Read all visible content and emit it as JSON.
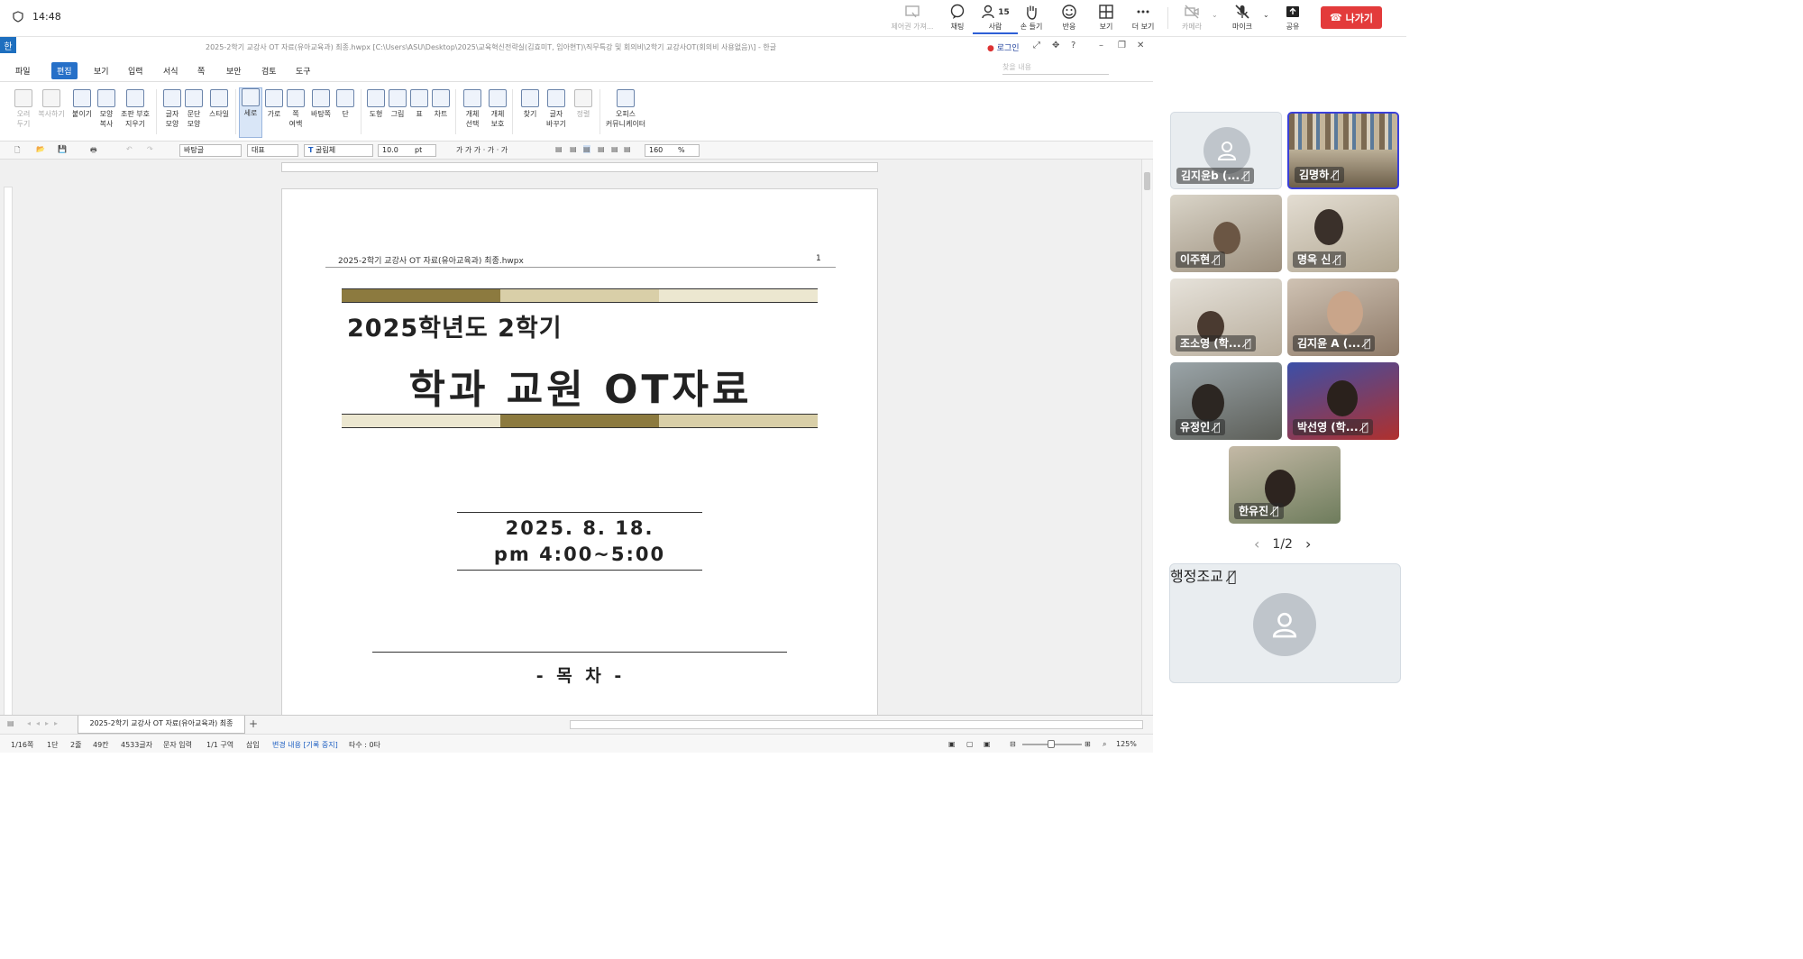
{
  "topbar": {
    "time": "14:48",
    "controls": [
      {
        "label": "제어권 가져...",
        "icon": "remote-control-icon"
      },
      {
        "label": "채팅",
        "icon": "chat-icon"
      },
      {
        "label": "사람",
        "icon": "people-icon",
        "count": "15"
      },
      {
        "label": "손 들기",
        "icon": "raise-hand-icon"
      },
      {
        "label": "반응",
        "icon": "reaction-icon"
      },
      {
        "label": "보기",
        "icon": "grid-view-icon"
      },
      {
        "label": "더 보기",
        "icon": "more-icon"
      },
      {
        "label": "카메라",
        "icon": "camera-off-icon"
      },
      {
        "label": "마이크",
        "icon": "mic-off-icon"
      },
      {
        "label": "공유",
        "icon": "share-icon"
      }
    ],
    "leave_label": "나가기"
  },
  "hwp": {
    "window_title": "2025-2학기 교강사 OT 자료(유아교육과) 최종.hwpx [C:\\Users\\ASU\\Desktop\\2025\\교육혁신전략실(김효미T, 임아현T)\\직무특강 및 회의비\\2학기 교강사OT(회의비 사용없음)\\] - 한글",
    "login": "로그인",
    "app_logo": "한",
    "menu": [
      "파일",
      "편집",
      "보기",
      "입력",
      "서식",
      "쪽",
      "보안",
      "검토",
      "도구"
    ],
    "menu_selected": "편집",
    "search_placeholder": "찾을 내용",
    "ribbon": [
      {
        "label": "오려\n두기",
        "dim": true
      },
      {
        "label": "복사하기",
        "dim": true
      },
      {
        "label": "붙이기"
      },
      {
        "label": "모양\n복사"
      },
      {
        "label": "조판 부호\n지우기"
      },
      {
        "label": "글자\n모양"
      },
      {
        "label": "문단\n모양"
      },
      {
        "label": "스타일"
      },
      {
        "label": "세로",
        "selected": true
      },
      {
        "label": "가로"
      },
      {
        "label": "쪽\n여백"
      },
      {
        "label": "바탕쪽"
      },
      {
        "label": "단"
      },
      {
        "label": "도형"
      },
      {
        "label": "그림"
      },
      {
        "label": "표"
      },
      {
        "label": "차트"
      },
      {
        "label": "개체\n선택"
      },
      {
        "label": "개체\n보호"
      },
      {
        "label": "찾기"
      },
      {
        "label": "글자\n바꾸기"
      },
      {
        "label": "정렬",
        "dim": true
      },
      {
        "label": "오피스\n커뮤니케이터"
      }
    ],
    "format": {
      "style": "바탕글",
      "lang": "대표",
      "font": "굴림체",
      "size": "10.0",
      "size_unit": "pt",
      "line_spacing": "160",
      "line_spacing_unit": "%",
      "glyphs": "가  가  가  ·  가  ·  가"
    },
    "document": {
      "header": "2025-2학기 교강사 OT 자료(유아교육과) 최종.hwpx",
      "page_number": "1",
      "title_line1": "2025학년도 2학기",
      "title_line2": "학과 교원 OT자료",
      "date": "2025. 8. 18.",
      "time": "pm 4:00~5:00",
      "toc": "- 목 차 -",
      "band_colors": {
        "dark": "#8c7a3f",
        "light": "#d9cfa8",
        "pale": "#ece7d0"
      }
    },
    "tab_name": "2025-2학기 교강사 OT 자료(유아교육과) 최종",
    "status": {
      "page": "1/16쪽",
      "column": "1단",
      "line": "2줄",
      "chars_pos": "49칸",
      "chars": "4533글자",
      "input": "문자 입력",
      "section": "1/1 구역",
      "mode": "삽입",
      "track": "변경 내용 [기록 중지]",
      "typing": "타수 : 0타",
      "zoom": "125%"
    }
  },
  "participants": {
    "tiles": [
      {
        "name": "김지윤b (...",
        "video": false,
        "speaking": false
      },
      {
        "name": "김명하",
        "video": true,
        "speaking": true
      },
      {
        "name": "이주현",
        "video": true,
        "speaking": false
      },
      {
        "name": "명옥 신",
        "video": true,
        "speaking": false
      },
      {
        "name": "조소영 (학...",
        "video": true,
        "speaking": false
      },
      {
        "name": "김지윤 A (...",
        "video": true,
        "speaking": false
      },
      {
        "name": "유정인",
        "video": true,
        "speaking": false
      },
      {
        "name": "박선영 (학...",
        "video": true,
        "speaking": false
      },
      {
        "name": "한유진",
        "video": true,
        "speaking": false
      }
    ],
    "pager": "1/2",
    "featured": {
      "name": "행정조교"
    }
  }
}
